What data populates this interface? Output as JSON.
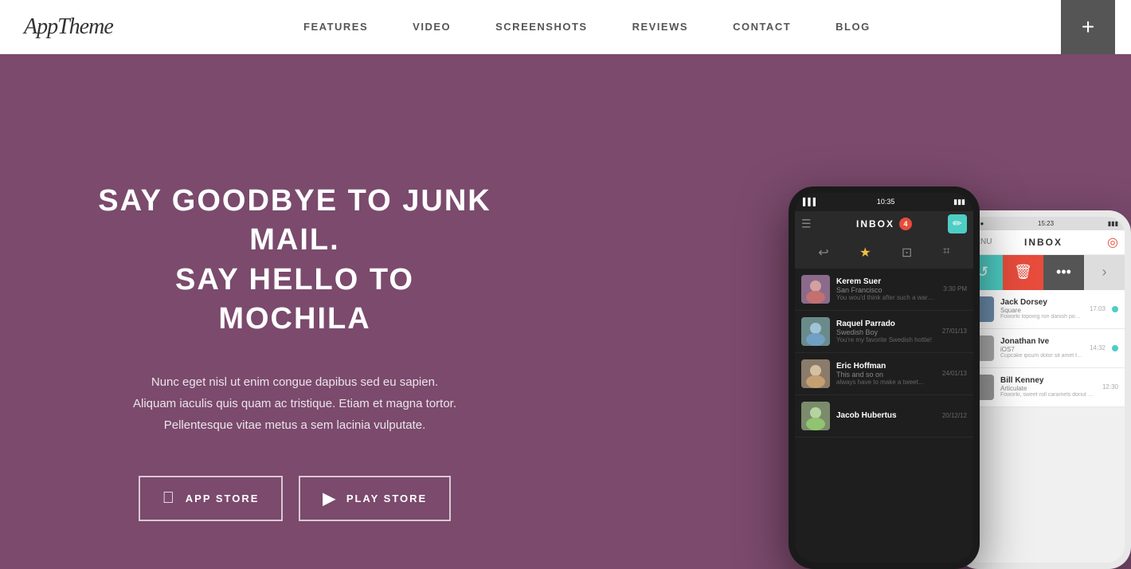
{
  "header": {
    "logo": "AppTheme",
    "nav_items": [
      "FEATURES",
      "VIDEO",
      "SCREENSHOTS",
      "REVIEWS",
      "CONTACT",
      "BLOG"
    ],
    "plus_btn": "+"
  },
  "hero": {
    "title_line1": "SAY GOODBYE TO JUNK MAIL.",
    "title_line2": "SAY HELLO TO MOCHILA",
    "subtitle_line1": "Nunc eget nisl ut enim congue dapibus sed eu sapien.",
    "subtitle_line2": "Aliquam iaculis quis quam ac tristique. Etiam et magna tortor.",
    "subtitle_line3": "Pellentesque vitae metus a sem lacinia vulputate.",
    "btn_app_store": "APP STORE",
    "btn_play_store": "PLAY STORE",
    "bg_color": "#7b4a6d"
  },
  "phone1": {
    "time": "10:35",
    "inbox_label": "INBOX",
    "inbox_count": "4",
    "mails": [
      {
        "name": "Kerem Suer",
        "sub": "San Francisco",
        "preview": "You wou'd think after such a warm...",
        "time": "3:30 PM"
      },
      {
        "name": "Raquel Parrado",
        "sub": "Swedish Boy",
        "preview": "You're my favorite Swedish hottie!",
        "time": "27/01/13"
      },
      {
        "name": "Eric Hoffman",
        "sub": "This and so on",
        "preview": "always have to make a tweet...",
        "time": "24/01/13"
      },
      {
        "name": "Jacob Hubertus",
        "sub": "",
        "preview": "",
        "time": "20/12/12"
      }
    ]
  },
  "phone2": {
    "time": "15:23",
    "inbox_label": "INBOX",
    "mails": [
      {
        "name": "Jack Dorsey",
        "sub": "Square",
        "preview": "Foworki topoing ron danish powder...",
        "time": "17:03"
      },
      {
        "name": "Jonathan Ive",
        "sub": "iOS7",
        "preview": "Cupcake ipsum dolor sit amet toori si...",
        "time": "14:32"
      },
      {
        "name": "Bill Kenney",
        "sub": "Articulate",
        "preview": "Foworki, sweet roll caramels donut brownies...",
        "time": "12:30"
      }
    ]
  }
}
